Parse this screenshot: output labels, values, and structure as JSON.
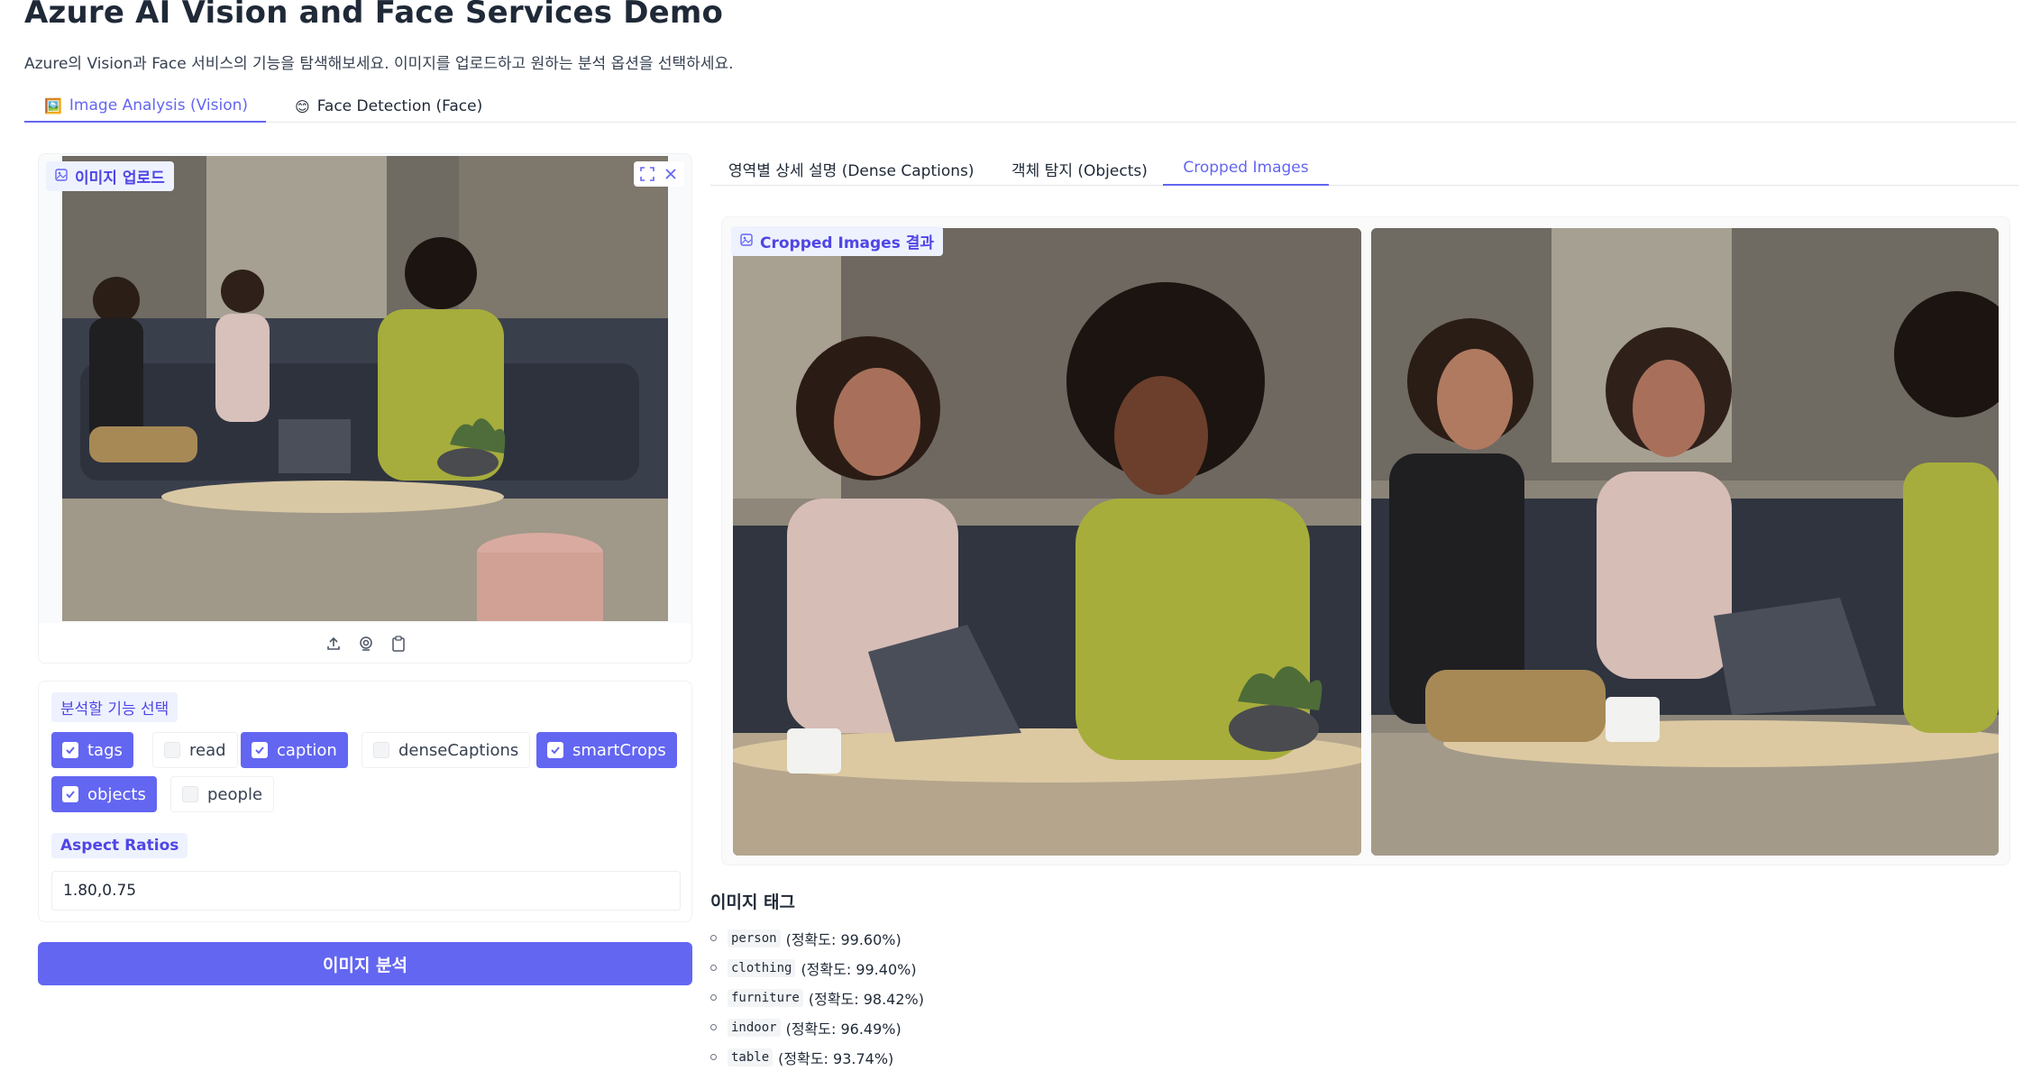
{
  "app": {
    "title": "Azure AI Vision and Face Services Demo",
    "subtitle": "Azure의 Vision과 Face 서비스의 기능을 탐색해보세요. 이미지를 업로드하고 원하는 분석 옵션을 선택하세요."
  },
  "main_tabs": [
    {
      "icon": "🖼️",
      "label": "Image Analysis (Vision)",
      "active": true
    },
    {
      "icon": "😊",
      "label": "Face Detection (Face)",
      "active": false
    }
  ],
  "upload": {
    "label": "이미지 업로드"
  },
  "options": {
    "label": "분석할 기능 선택",
    "features": [
      {
        "label": "tags",
        "checked": true
      },
      {
        "label": "read",
        "checked": false
      },
      {
        "label": "caption",
        "checked": true
      },
      {
        "label": "denseCaptions",
        "checked": false
      },
      {
        "label": "smartCrops",
        "checked": true
      },
      {
        "label": "objects",
        "checked": true
      },
      {
        "label": "people",
        "checked": false
      }
    ],
    "aspect_label": "Aspect Ratios",
    "aspect_value": "1.80,0.75"
  },
  "analyze_button": "이미지 분석",
  "result_tabs": [
    {
      "label": "영역별 상세 설명 (Dense Captions)",
      "active": false
    },
    {
      "label": "객체 탐지 (Objects)",
      "active": false
    },
    {
      "label": "Cropped Images",
      "active": true
    }
  ],
  "gallery": {
    "label": "Cropped Images 결과"
  },
  "tags": {
    "title": "이미지 태그",
    "items": [
      {
        "name": "person",
        "confidence": "(정확도: 99.60%)"
      },
      {
        "name": "clothing",
        "confidence": "(정확도: 99.40%)"
      },
      {
        "name": "furniture",
        "confidence": "(정확도: 98.42%)"
      },
      {
        "name": "indoor",
        "confidence": "(정확도: 96.49%)"
      },
      {
        "name": "table",
        "confidence": "(정확도: 93.74%)"
      }
    ]
  },
  "colors": {
    "accent": "#6366f1",
    "accent_light": "#eef2ff"
  }
}
